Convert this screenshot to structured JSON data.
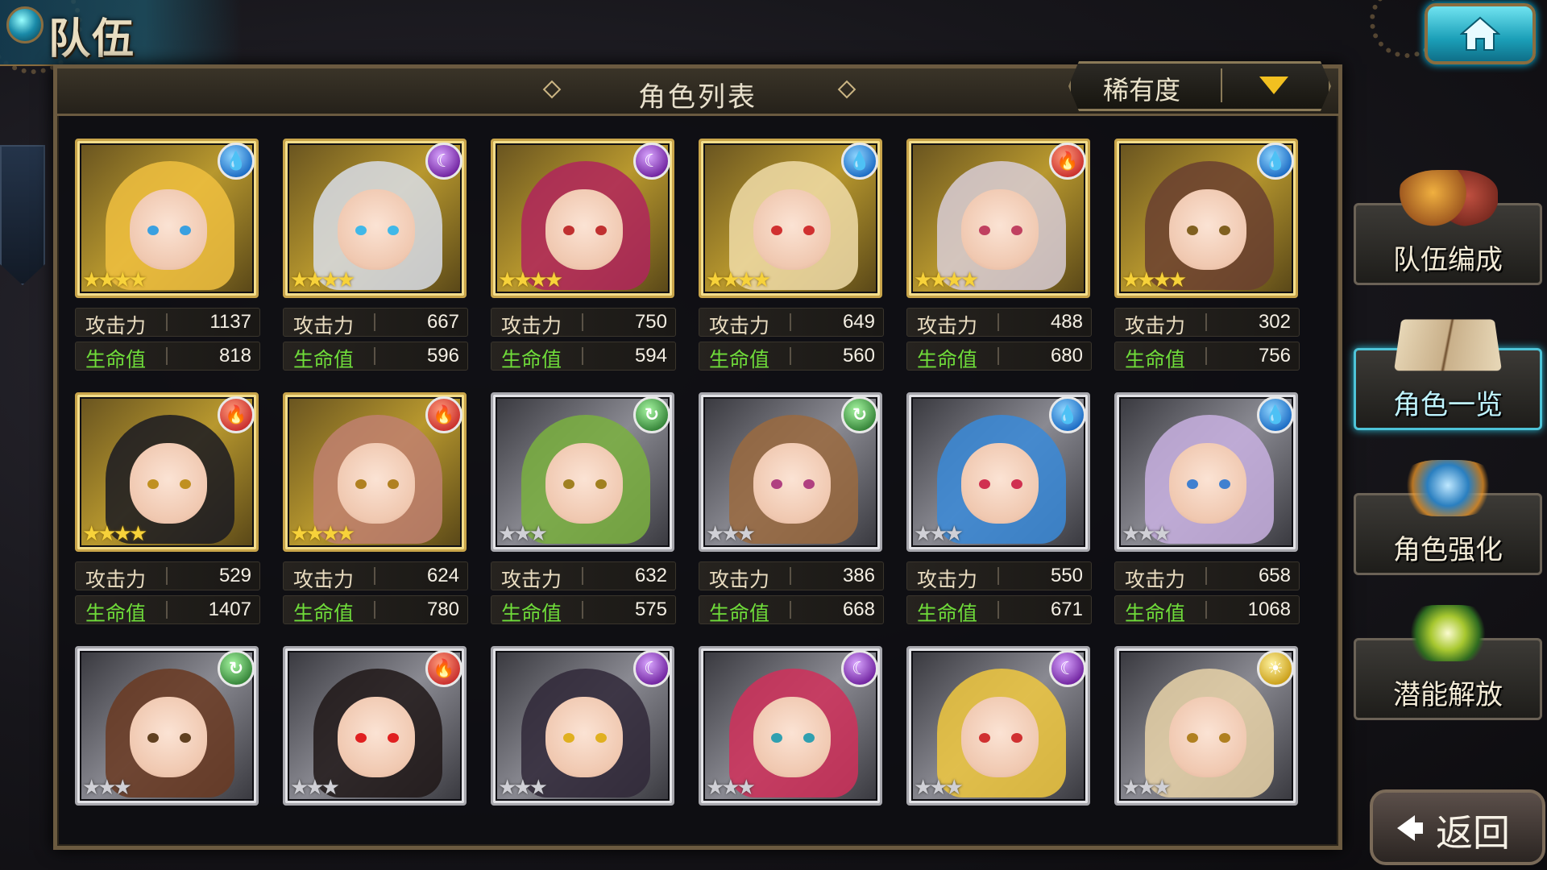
{
  "header": {
    "title": "队伍",
    "home_icon": "home-icon"
  },
  "panel": {
    "title": "角色列表"
  },
  "sort": {
    "label": "稀有度"
  },
  "stat_labels": {
    "atk": "攻击力",
    "hp": "生命值"
  },
  "side_menu": {
    "team_formation": "队伍编成",
    "character_list": "角色一览",
    "character_enhance": "角色强化",
    "potential_release": "潜能解放"
  },
  "back": {
    "label": "返回"
  },
  "colors": {
    "accent_teal": "#2bb6cf",
    "hp_green": "#6fdc3a",
    "gold_frame": "#c8a44a",
    "silver_frame": "#a7a7ad",
    "sort_arrow": "#f2c020"
  },
  "cards": [
    {
      "element": "water",
      "rarity": 4,
      "atk": "1137",
      "hp": "818",
      "hair": "#f0c040",
      "eye": "#3aa0e0"
    },
    {
      "element": "dark",
      "rarity": 4,
      "atk": "667",
      "hp": "596",
      "hair": "#d8dde8",
      "eye": "#40b8e8"
    },
    {
      "element": "dark",
      "rarity": 4,
      "atk": "750",
      "hp": "594",
      "hair": "#b0245c",
      "eye": "#c03030"
    },
    {
      "element": "water",
      "rarity": 4,
      "atk": "649",
      "hp": "560",
      "hair": "#f0dca8",
      "eye": "#d03030"
    },
    {
      "element": "fire",
      "rarity": 4,
      "atk": "488",
      "hp": "680",
      "hair": "#d8cdd6",
      "eye": "#c04060"
    },
    {
      "element": "water",
      "rarity": 4,
      "atk": "302",
      "hp": "756",
      "hair": "#6a4030",
      "eye": "#806020"
    },
    {
      "element": "fire",
      "rarity": 4,
      "atk": "529",
      "hp": "1407",
      "hair": "#1a1a22",
      "eye": "#c09020"
    },
    {
      "element": "fire",
      "rarity": 4,
      "atk": "624",
      "hp": "780",
      "hair": "#c08070",
      "eye": "#b08020"
    },
    {
      "element": "wind",
      "rarity": 3,
      "atk": "632",
      "hp": "575",
      "hair": "#7ab040",
      "eye": "#a08020"
    },
    {
      "element": "wind",
      "rarity": 3,
      "atk": "386",
      "hp": "668",
      "hair": "#9a6a40",
      "eye": "#b04080"
    },
    {
      "element": "water",
      "rarity": 3,
      "atk": "550",
      "hp": "671",
      "hair": "#3a8ad8",
      "eye": "#d03050"
    },
    {
      "element": "water",
      "rarity": 3,
      "atk": "658",
      "hp": "1068",
      "hair": "#c8b0e0",
      "eye": "#4080d0"
    },
    {
      "element": "wind",
      "rarity": 3,
      "hair": "#6a3a22",
      "eye": "#604020"
    },
    {
      "element": "fire",
      "rarity": 3,
      "hair": "#201818",
      "eye": "#e02020"
    },
    {
      "element": "dark",
      "rarity": 3,
      "hair": "#302838",
      "eye": "#e0b020"
    },
    {
      "element": "dark",
      "rarity": 3,
      "hair": "#d0305a",
      "eye": "#30a0b0"
    },
    {
      "element": "dark",
      "rarity": 3,
      "hair": "#f0c840",
      "eye": "#d03030"
    },
    {
      "element": "light",
      "rarity": 3,
      "hair": "#e8d2a8",
      "eye": "#b08020"
    }
  ]
}
